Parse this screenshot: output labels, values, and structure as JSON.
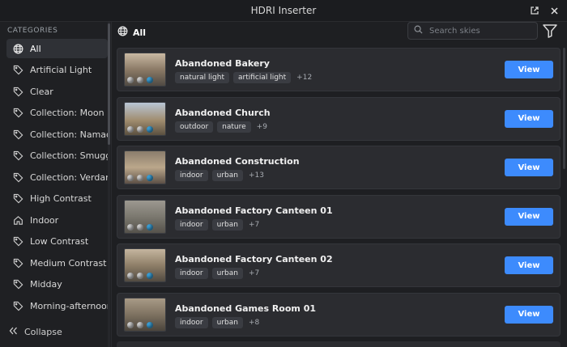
{
  "window": {
    "title": "HDRI Inserter"
  },
  "sidebar": {
    "heading": "CATEGORIES",
    "items": [
      {
        "label": "All",
        "icon": "globe-icon",
        "active": true
      },
      {
        "label": "Artificial Light",
        "icon": "tag-icon"
      },
      {
        "label": "Clear",
        "icon": "tag-icon"
      },
      {
        "label": "Collection: Moon",
        "icon": "tag-icon"
      },
      {
        "label": "Collection: Namaqu",
        "icon": "tag-icon"
      },
      {
        "label": "Collection: Smuggle",
        "icon": "tag-icon"
      },
      {
        "label": "Collection: Verdant",
        "icon": "tag-icon"
      },
      {
        "label": "High Contrast",
        "icon": "tag-icon"
      },
      {
        "label": "Indoor",
        "icon": "home-icon"
      },
      {
        "label": "Low Contrast",
        "icon": "tag-icon"
      },
      {
        "label": "Medium Contrast",
        "icon": "tag-icon"
      },
      {
        "label": "Midday",
        "icon": "tag-icon"
      },
      {
        "label": "Morning-afternoon",
        "icon": "tag-icon"
      }
    ],
    "collapse_label": "Collapse"
  },
  "toolbar": {
    "current_category": "All",
    "search_placeholder": "Search skies",
    "filter_icon": "filter-icon"
  },
  "results": [
    {
      "name": "Abandoned Bakery",
      "tags": [
        "natural light",
        "artificial light"
      ],
      "more": "+12",
      "view_label": "View"
    },
    {
      "name": "Abandoned Church",
      "tags": [
        "outdoor",
        "nature"
      ],
      "more": "+9",
      "view_label": "View"
    },
    {
      "name": "Abandoned Construction",
      "tags": [
        "indoor",
        "urban"
      ],
      "more": "+13",
      "view_label": "View"
    },
    {
      "name": "Abandoned Factory Canteen 01",
      "tags": [
        "indoor",
        "urban"
      ],
      "more": "+7",
      "view_label": "View"
    },
    {
      "name": "Abandoned Factory Canteen 02",
      "tags": [
        "indoor",
        "urban"
      ],
      "more": "+7",
      "view_label": "View"
    },
    {
      "name": "Abandoned Games Room 01",
      "tags": [
        "indoor",
        "urban"
      ],
      "more": "+8",
      "view_label": "View"
    }
  ],
  "colors": {
    "accent": "#3d8bfd",
    "background": "#1e1f22",
    "card": "#2b2c30"
  }
}
